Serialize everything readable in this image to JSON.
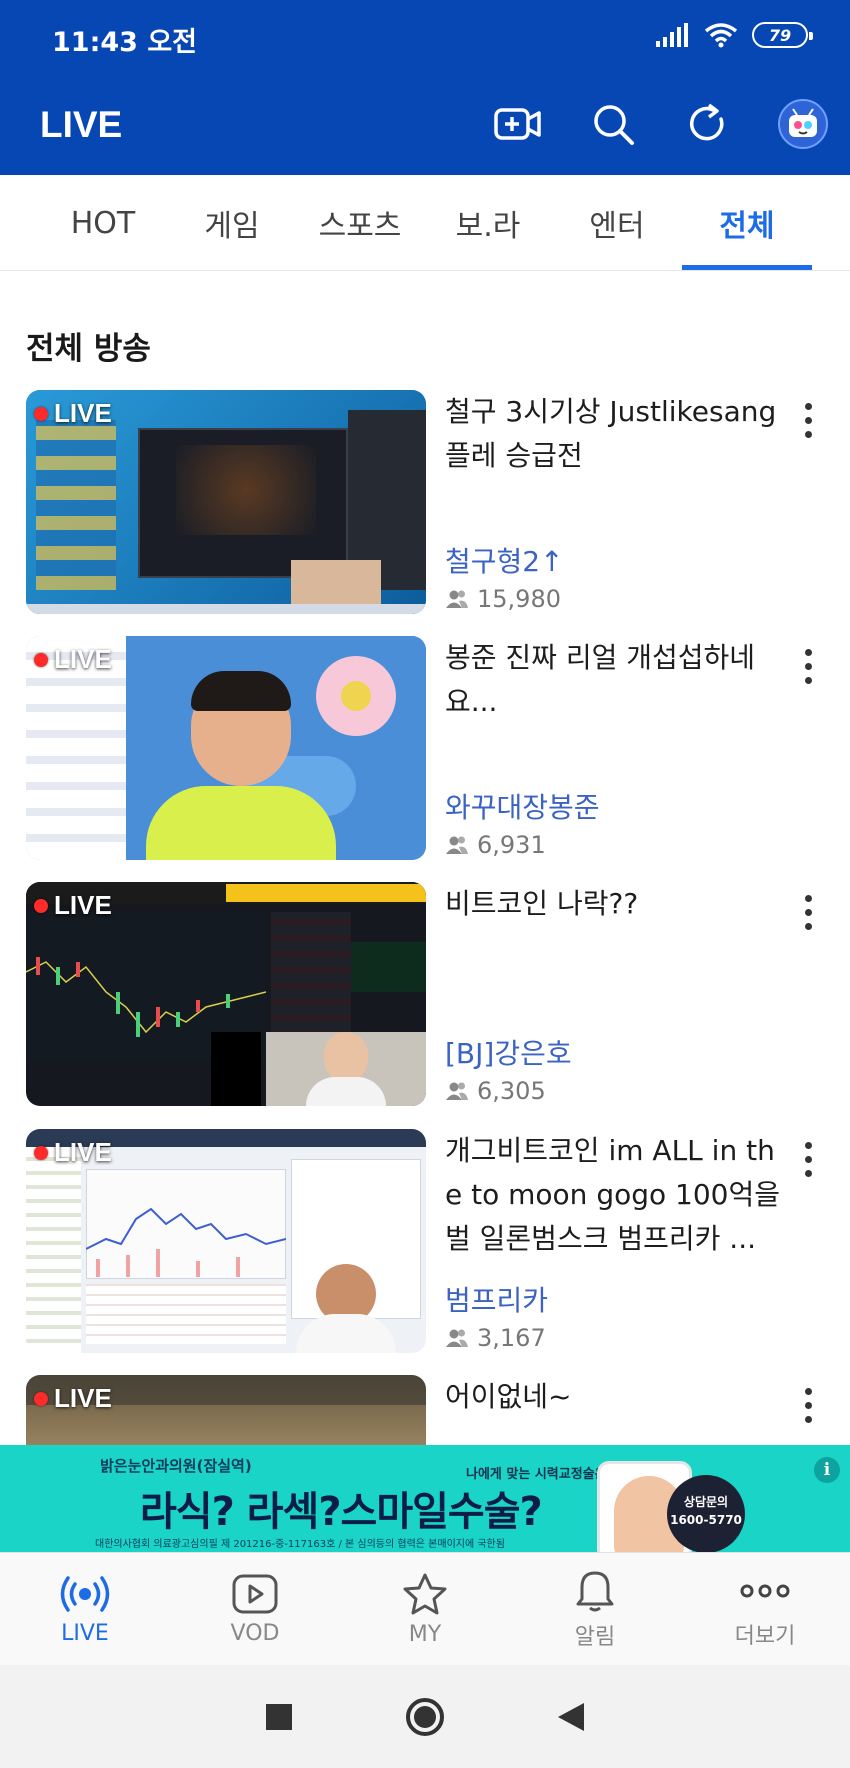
{
  "status_bar": {
    "time": "11:43 오전",
    "battery": "79"
  },
  "app_bar": {
    "title": "LIVE"
  },
  "tabs": [
    {
      "label": "HOT"
    },
    {
      "label": "게임"
    },
    {
      "label": "스포츠"
    },
    {
      "label": "보.라"
    },
    {
      "label": "엔터"
    },
    {
      "label": "전체"
    }
  ],
  "section": {
    "title": "전체 방송"
  },
  "broadcasts": [
    {
      "badge": "LIVE",
      "title": "철구 3시기상 Justlikesang 플레 승급전",
      "channel": "철구형2↑",
      "viewers": "15,980"
    },
    {
      "badge": "LIVE",
      "title": "봉준 진짜 리얼 개섭섭하네요...",
      "channel": "와꾸대장봉준",
      "viewers": "6,931"
    },
    {
      "badge": "LIVE",
      "title": "비트코인 나락??",
      "channel": "[BJ]강은호",
      "viewers": "6,305"
    },
    {
      "badge": "LIVE",
      "title": "개그비트코인 im ALL in the to moon gogo 100억을 벌 일론범스크 범프리카 ...",
      "channel": "범프리카",
      "viewers": "3,167"
    },
    {
      "badge": "LIVE",
      "title": "어이없네~"
    }
  ],
  "ad": {
    "clinic": "밝은눈안과의원(잠실역)",
    "headline": "라식? 라섹?스마일수술?",
    "tagline": "나에게 맞는 시력교정술은?",
    "consult": "상담문의",
    "phone": "1600-5770",
    "fine_print": "대한의사협회 의료광고심의필 제 201216-중-117163호 / 본 심의등의 협력은 본매이지에 국한됨",
    "info_icon": "i"
  },
  "bottom_nav": [
    {
      "label": "LIVE"
    },
    {
      "label": "VOD"
    },
    {
      "label": "MY"
    },
    {
      "label": "알림"
    },
    {
      "label": "더보기"
    }
  ],
  "colors": {
    "brand_blue": "#0747b3",
    "accent": "#1e6be6",
    "channel": "#3a63c4",
    "live_red": "#ff2a2a",
    "ad_bg": "#19d4c7"
  }
}
